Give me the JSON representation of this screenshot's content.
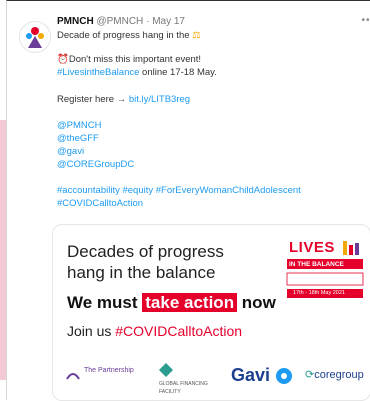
{
  "tweet": {
    "author_name": "PMNCH",
    "author_handle": "@PMNCH",
    "date": "May 17",
    "header_line": "Decade of progress hang in the",
    "line_event": "Don't miss this important event!",
    "line_hashtag_event": "#LivesintheBalance",
    "line_event_dates": " online 17-18 May.",
    "register_prefix": "Register here ",
    "register_arrow": "→",
    "register_link": "bit.ly/LITB3reg",
    "mentions": [
      "@PMNCH",
      "@theGFF",
      "@gavi",
      "@COREGroupDC"
    ],
    "hashtags_line1": "#accountability #equity #ForEveryWomanChildAdolescent",
    "hashtags_line2": "#COVIDCalltoAction"
  },
  "banner": {
    "title_line1": "Decades of progress",
    "title_line2": "hang in the balance",
    "action_prefix": "We must ",
    "action_highlight": "take action",
    "action_suffix": " now",
    "join_prefix": "Join us ",
    "join_hashtag": "#COVIDCalltoAction",
    "lives_title": "LIVES",
    "lives_subtitle": "IN THE BALANCE",
    "lives_dates": "17th - 18th May 2021",
    "logo_partnership": "The Partnership",
    "logo_gff": "GLOBAL FINANCING FACILITY",
    "logo_gavi": "Gavi",
    "logo_core": "coregroup"
  },
  "colors": {
    "accent_blue": "#1d9bf0",
    "brand_red": "#e4002b"
  }
}
